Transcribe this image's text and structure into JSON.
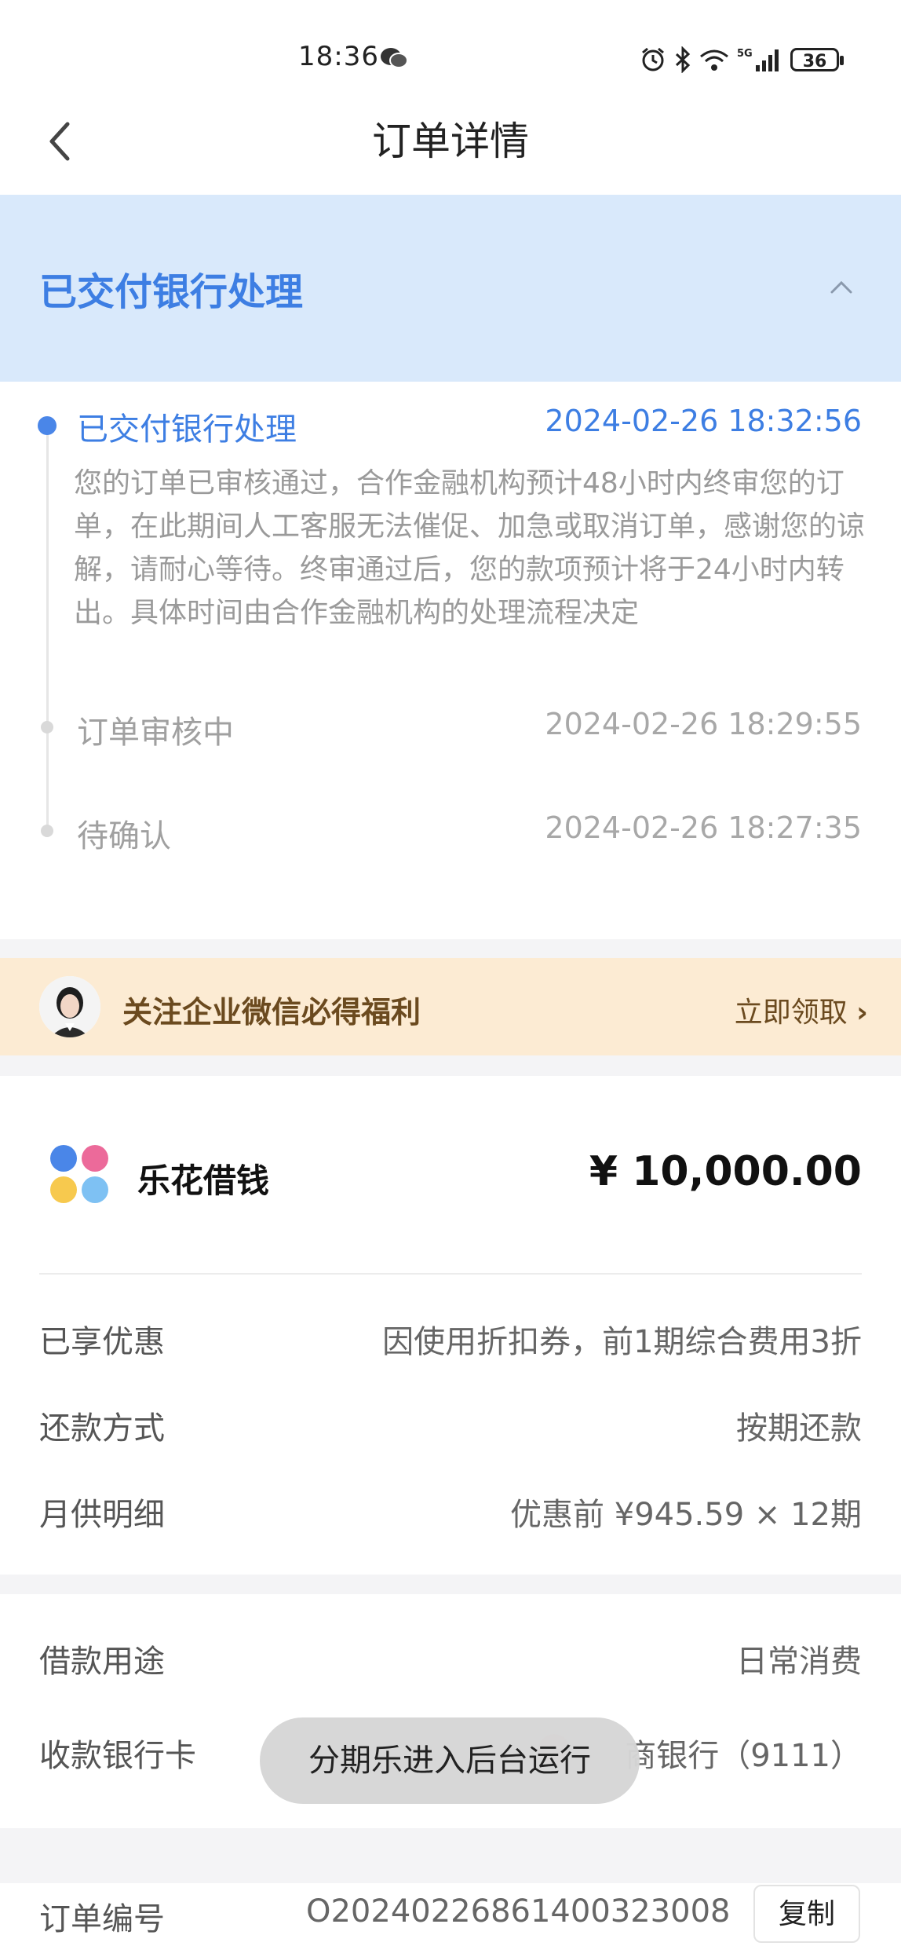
{
  "status_bar": {
    "time": "18:36",
    "network": "5G",
    "battery": "36"
  },
  "nav": {
    "title": "订单详情"
  },
  "status_banner": {
    "title": "已交付银行处理"
  },
  "timeline": [
    {
      "title": "已交付银行处理",
      "time": "2024-02-26 18:32:56",
      "desc": "您的订单已审核通过，合作金融机构预计48小时内终审您的订单，在此期间人工客服无法催促、加急或取消订单，感谢您的谅解，请耐心等待。终审通过后，您的款项预计将于24小时内转出。具体时间由合作金融机构的处理流程决定"
    },
    {
      "title": "订单审核中",
      "time": "2024-02-26 18:29:55"
    },
    {
      "title": "待确认",
      "time": "2024-02-26 18:27:35"
    }
  ],
  "promo": {
    "text": "关注企业微信必得福利",
    "link": "立即领取"
  },
  "product": {
    "name": "乐花借钱",
    "amount": "¥ 10,000.00",
    "rows": [
      {
        "label": "已享优惠",
        "value": "因使用折扣券，前1期综合费用3折"
      },
      {
        "label": "还款方式",
        "value": "按期还款"
      },
      {
        "label": "月供明细",
        "value": "优惠前 ¥945.59 × 12期"
      }
    ]
  },
  "loan": {
    "purpose_label": "借款用途",
    "purpose_value": "日常消费",
    "card_label": "收款银行卡",
    "card_value": "商银行（9111）"
  },
  "toast": {
    "text": "分期乐进入后台运行"
  },
  "order": {
    "label": "订单编号",
    "number": "O20240226861400323008",
    "copy_label": "复制"
  },
  "colors": {
    "accent": "#3d7ee3",
    "banner_bg": "#d9e9fb",
    "promo_bg": "#fcebd3"
  }
}
